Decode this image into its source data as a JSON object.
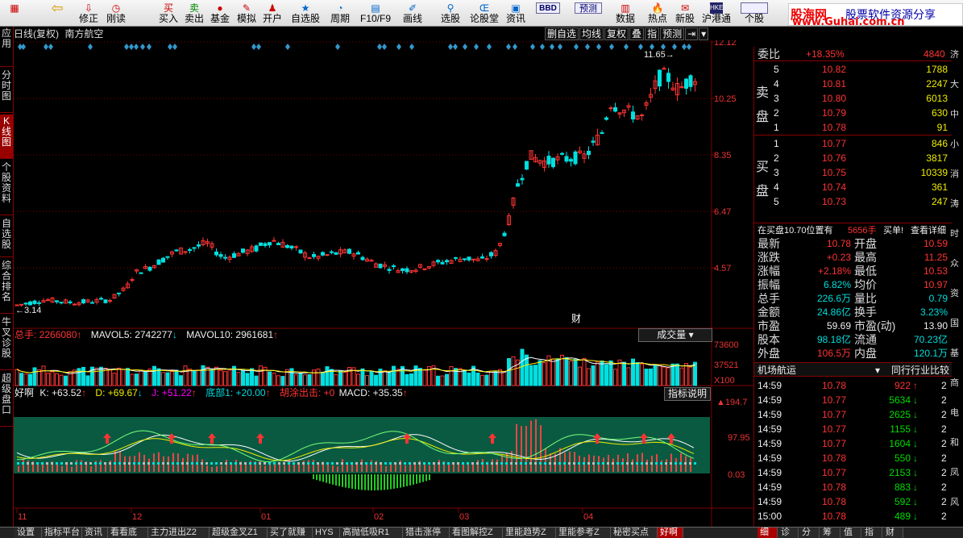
{
  "toolbar": {
    "buttons": [
      {
        "label": "修正",
        "icon": "undo-icon"
      },
      {
        "label": "刚读",
        "icon": "clock-icon"
      },
      {
        "label": "买入",
        "icon": "buy-icon"
      },
      {
        "label": "卖出",
        "icon": "sell-icon"
      },
      {
        "label": "基金",
        "icon": "fund-icon"
      },
      {
        "label": "模拟",
        "icon": "simulate-icon"
      },
      {
        "label": "开户",
        "icon": "account-icon"
      },
      {
        "label": "自选股",
        "icon": "star-icon"
      },
      {
        "label": "周期",
        "icon": "cycle-icon"
      },
      {
        "label": "F10/F9",
        "icon": "f10-icon"
      },
      {
        "label": "画线",
        "icon": "pen-icon"
      },
      {
        "label": "选股",
        "icon": "select-icon"
      },
      {
        "label": "论股堂",
        "icon": "forum-icon"
      },
      {
        "label": "资讯",
        "icon": "news-icon"
      },
      {
        "label": "BBD",
        "icon": "bbd-icon"
      },
      {
        "label": "预测",
        "icon": "forecast-icon"
      },
      {
        "label": "数据",
        "icon": "data-icon"
      },
      {
        "label": "热点",
        "icon": "hot-icon"
      },
      {
        "label": "新股",
        "icon": "newstock-icon"
      },
      {
        "label": "沪港通",
        "icon": "hk-icon"
      },
      {
        "label": "个股",
        "icon": "stock-icon"
      }
    ],
    "logo_line1": "股海网",
    "logo_line2": "股票软件资源分享",
    "logo_line3": "www.Guhai.com.cn"
  },
  "sidebar": [
    "应用",
    "分时图",
    "K线图",
    "个股资料",
    "自选股",
    "综合排名",
    "牛叉诊股",
    "超级盘口"
  ],
  "chart": {
    "title": "日线(复权)",
    "stock_name": "南方航空",
    "tabs": [
      "删自选",
      "均线",
      "复权",
      "叠",
      "指",
      "预测"
    ],
    "price_axis": [
      "12.12",
      "10.25",
      "8.35",
      "6.47",
      "4.57"
    ],
    "high_label": "11.65",
    "low_label": "3.14",
    "cai_label": "财",
    "month_labels": [
      "11",
      "12",
      "01",
      "02",
      "03",
      "04"
    ]
  },
  "volume": {
    "legend_total": "总手: 2266080",
    "legend_ma5": "MAVOL5: 2742277",
    "legend_ma10": "MAVOL10: 2961681",
    "button": "成交量",
    "axis": [
      "73600",
      "37521",
      "X100"
    ]
  },
  "indicator": {
    "name": "好啊",
    "k": "K: +63.52",
    "d": "D: +69.67",
    "j": "J: +51.22",
    "bottom": "底部1: +20.00",
    "hutu": "胡涂出击: +0",
    "macd": "MACD: +35.35",
    "button": "指标说明",
    "axis": [
      "194.7",
      "97.95",
      "0.03"
    ]
  },
  "quote": {
    "webi_label": "委比",
    "webi_value": "+18.35%",
    "webi_diff": "4840",
    "sell_label": "卖盘",
    "buy_label": "买盘",
    "sell": [
      [
        "5",
        "10.82",
        "1788"
      ],
      [
        "4",
        "10.81",
        "2247"
      ],
      [
        "3",
        "10.80",
        "6013"
      ],
      [
        "2",
        "10.79",
        "630"
      ],
      [
        "1",
        "10.78",
        "91"
      ]
    ],
    "buy": [
      [
        "1",
        "10.77",
        "846"
      ],
      [
        "2",
        "10.76",
        "3817"
      ],
      [
        "3",
        "10.75",
        "10339"
      ],
      [
        "4",
        "10.74",
        "361"
      ],
      [
        "5",
        "10.73",
        "247"
      ]
    ],
    "notice_a": "在买盘10.70位置有",
    "notice_b": "5656手",
    "notice_c": "买单!",
    "notice_d": "查看详细",
    "stats": [
      [
        "最新",
        "10.78",
        "开盘",
        "10.59"
      ],
      [
        "涨跌",
        "+0.23",
        "最高",
        "11.25"
      ],
      [
        "涨幅",
        "+2.18%",
        "最低",
        "10.53"
      ],
      [
        "振幅",
        "6.82%",
        "均价",
        "10.97"
      ],
      [
        "总手",
        "226.6万",
        "量比",
        "0.79"
      ],
      [
        "金额",
        "24.86亿",
        "换手",
        "3.23%"
      ],
      [
        "市盈",
        "59.69",
        "市盈(动)",
        "13.90"
      ],
      [
        "股本",
        "98.18亿",
        "流通",
        "70.23亿"
      ],
      [
        "外盘",
        "106.5万",
        "内盘",
        "120.1万"
      ]
    ],
    "sector": "机场航运",
    "compare": "同行行业比较",
    "ticks": [
      [
        "14:59",
        "10.78",
        "922",
        "up"
      ],
      [
        "14:59",
        "10.77",
        "5634",
        "down"
      ],
      [
        "14:59",
        "10.77",
        "2625",
        "down"
      ],
      [
        "14:59",
        "10.77",
        "1155",
        "down"
      ],
      [
        "14:59",
        "10.77",
        "1604",
        "down"
      ],
      [
        "14:59",
        "10.78",
        "550",
        "down"
      ],
      [
        "14:59",
        "10.77",
        "2153",
        "down"
      ],
      [
        "14:59",
        "10.78",
        "883",
        "down"
      ],
      [
        "14:59",
        "10.78",
        "592",
        "down"
      ],
      [
        "15:00",
        "10.78",
        "489",
        "down"
      ]
    ],
    "tick_suffix": "2"
  },
  "right_edge": [
    "济",
    "大",
    "中",
    "小",
    "消",
    "涛",
    "时",
    "众",
    "资",
    "国",
    "基",
    "商",
    "电",
    "和",
    "凤",
    "风"
  ],
  "bottom_tabs": [
    "设置",
    "指标平台",
    "资讯",
    "看看底",
    "主力进出Z2",
    "超级金叉Z1",
    "买了就赚",
    "HYS",
    "高抛低吸R1",
    "猎击涨停",
    "看图解控Z",
    "里能趋势Z",
    "里能参考Z",
    "秘密买点",
    "好啊"
  ],
  "bottom_right_tabs": [
    "细",
    "诊",
    "分",
    "筹",
    "值",
    "指",
    "财"
  ],
  "colors": {
    "up": "#ff3333",
    "down": "#00e0e0",
    "ma5": "#ffffff",
    "ma10": "#ffee00",
    "grid": "#800000",
    "label_white": "#dddddd"
  }
}
